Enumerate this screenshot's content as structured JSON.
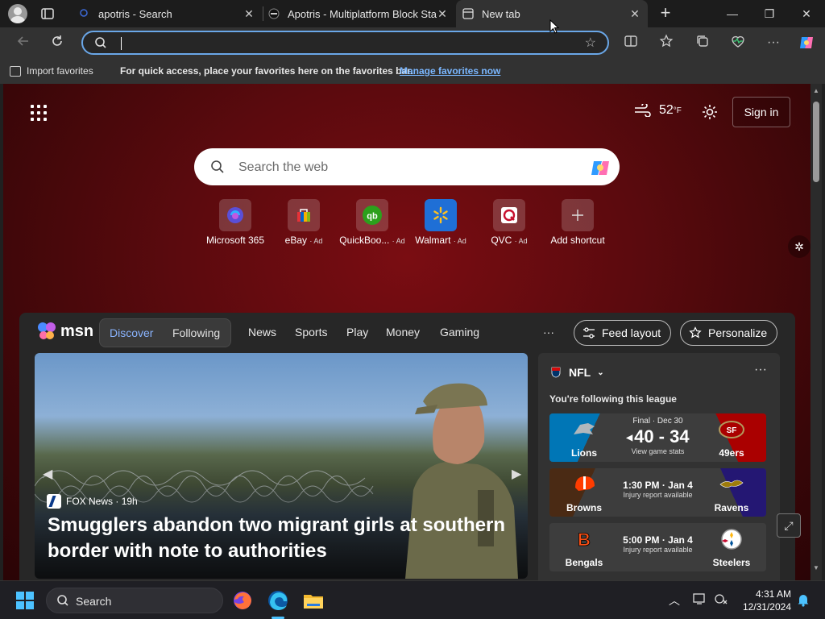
{
  "browser": {
    "tabs": [
      {
        "title": "apotris - Search",
        "close": "✕"
      },
      {
        "title": "Apotris - Multiplatform Block Stac",
        "close": "✕"
      },
      {
        "title": "New tab",
        "close": "✕"
      }
    ],
    "new_tab": "+",
    "window": {
      "minimize": "—",
      "maximize": "❐",
      "close": "✕"
    },
    "address": {
      "value": ""
    }
  },
  "favorites_bar": {
    "import_label": "Import favorites",
    "tip": "For quick access, place your favorites here on the favorites bar.",
    "manage_link": "Manage favorites now"
  },
  "ntp": {
    "weather": {
      "temp": "52",
      "unit": "°F"
    },
    "sign_in": "Sign in",
    "search_placeholder": "Search the web",
    "shortcuts": [
      {
        "label": "Microsoft 365",
        "ad": ""
      },
      {
        "label": "eBay",
        "ad": "· Ad"
      },
      {
        "label": "QuickBoo...",
        "ad": "· Ad"
      },
      {
        "label": "Walmart",
        "ad": "· Ad"
      },
      {
        "label": "QVC",
        "ad": "· Ad"
      },
      {
        "label": "Add shortcut",
        "ad": ""
      }
    ]
  },
  "feed": {
    "logo": "msn",
    "toggle": {
      "discover": "Discover",
      "following": "Following"
    },
    "nav": [
      "News",
      "Sports",
      "Play",
      "Money",
      "Gaming"
    ],
    "more": "···",
    "feed_layout": "Feed layout",
    "personalize": "Personalize",
    "hero": {
      "source": "FOX News",
      "age": "· 19h",
      "headline": "Smugglers abandon two migrant girls at southern border with note to authorities"
    },
    "nfl": {
      "title": "NFL",
      "more": "···",
      "subtitle": "You're following this league",
      "games": [
        {
          "home": "Lions",
          "away": "49ers",
          "status": "Final · Dec 30",
          "score": "40 - 34",
          "note": "View game stats"
        },
        {
          "home": "Browns",
          "away": "Ravens",
          "time": "1:30 PM · Jan 4",
          "note": "Injury report available"
        },
        {
          "home": "Bengals",
          "away": "Steelers",
          "time": "5:00 PM · Jan 4",
          "note": "Injury report available"
        }
      ]
    }
  },
  "taskbar": {
    "search_label": "Search",
    "time": "4:31 AM",
    "date": "12/31/2024"
  },
  "colors": {
    "accent": "#4cc2ff",
    "link": "#7ab7ff",
    "discover": "#8ab4ff",
    "ntp_bg": "#5b0a0e"
  }
}
